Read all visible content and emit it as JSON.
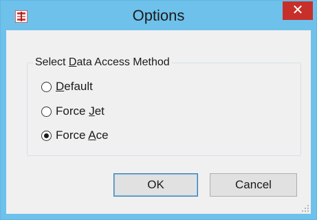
{
  "window": {
    "title": "Options",
    "close_symbol": "✕",
    "app_icon": "options-app-icon",
    "colors": {
      "titlebar": "#6ec1ea",
      "close_button": "#c7302a",
      "client": "#f0f0f0"
    }
  },
  "group": {
    "label_pre": "Select ",
    "label_accel": "D",
    "label_post": "ata Access Method"
  },
  "options": [
    {
      "pre": "",
      "accel": "D",
      "post": "efault",
      "selected": false
    },
    {
      "pre": "Force ",
      "accel": "J",
      "post": "et",
      "selected": false
    },
    {
      "pre": "Force ",
      "accel": "A",
      "post": "ce",
      "selected": true
    }
  ],
  "buttons": {
    "ok_label": "OK",
    "cancel_label": "Cancel"
  }
}
